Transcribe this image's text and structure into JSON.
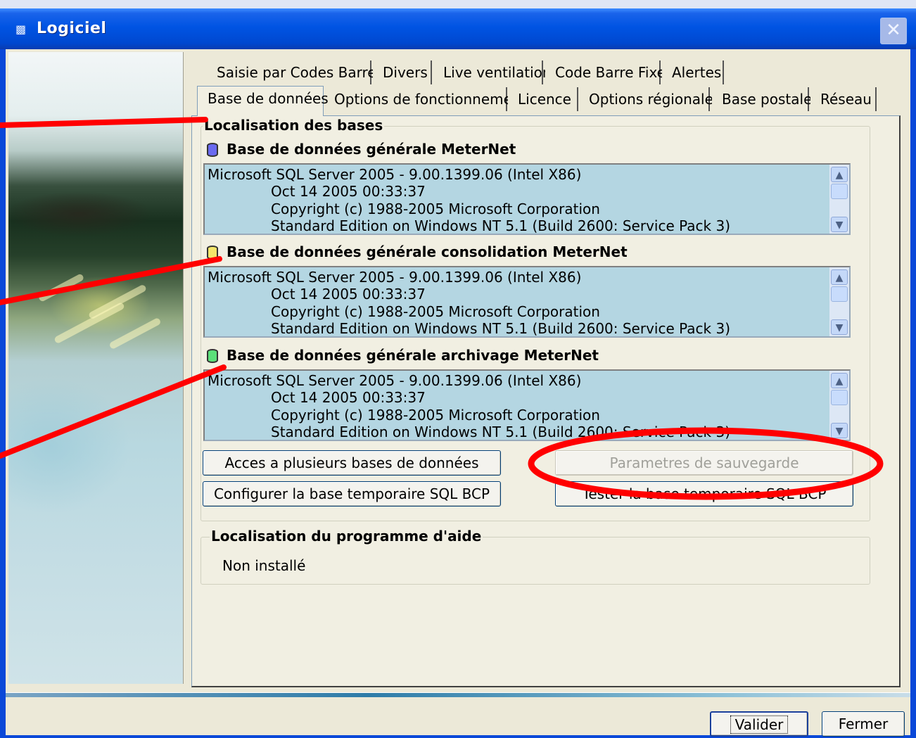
{
  "window": {
    "title": "Logiciel",
    "close_symbol": "✕"
  },
  "tabs": {
    "row1": [
      "Saisie par Codes Barres",
      "Divers",
      "Live ventilation",
      "Code Barre Fixe",
      "Alertes"
    ],
    "row2": [
      "Base de données",
      "Options de fonctionnement",
      "Licence",
      "Options régionales",
      "Base postale",
      "Réseau"
    ],
    "active": "Base de données"
  },
  "bases_group": {
    "title": "Localisation des bases",
    "databases": [
      {
        "name": "Base de données générale MeterNet",
        "icon": "database-blue-icon",
        "color": "#6a6af0",
        "lines": [
          "Microsoft SQL Server 2005 - 9.00.1399.06 (Intel X86)",
          "Oct 14 2005 00:33:37",
          "Copyright (c) 1988-2005 Microsoft Corporation",
          "Standard Edition on Windows NT 5.1 (Build 2600: Service Pack 3)"
        ]
      },
      {
        "name": "Base de données générale consolidation MeterNet",
        "icon": "database-yellow-icon",
        "color": "#f4e66a",
        "lines": [
          "Microsoft SQL Server 2005 - 9.00.1399.06 (Intel X86)",
          "Oct 14 2005 00:33:37",
          "Copyright (c) 1988-2005 Microsoft Corporation",
          "Standard Edition on Windows NT 5.1 (Build 2600: Service Pack 3)"
        ]
      },
      {
        "name": "Base de données générale archivage MeterNet",
        "icon": "database-green-icon",
        "color": "#5ce07a",
        "lines": [
          "Microsoft SQL Server 2005 - 9.00.1399.06 (Intel X86)",
          "Oct 14 2005 00:33:37",
          "Copyright (c) 1988-2005 Microsoft Corporation",
          "Standard Edition on Windows NT 5.1 (Build 2600: Service Pack 3)"
        ]
      }
    ],
    "buttons": {
      "multi_access": "Acces a plusieurs bases de données",
      "backup_params": "Parametres de sauvegarde",
      "configure_bcp": "Configurer la base temporaire SQL BCP",
      "test_bcp": "Tester la base temporaire SQL BCP"
    }
  },
  "help_group": {
    "title": "Localisation du programme d'aide",
    "value": "Non installé"
  },
  "footer": {
    "validate": "Valider",
    "close": "Fermer"
  },
  "annotation_color": "#ff0000",
  "scroll_arrows": {
    "up": "▲",
    "down": "▼"
  }
}
